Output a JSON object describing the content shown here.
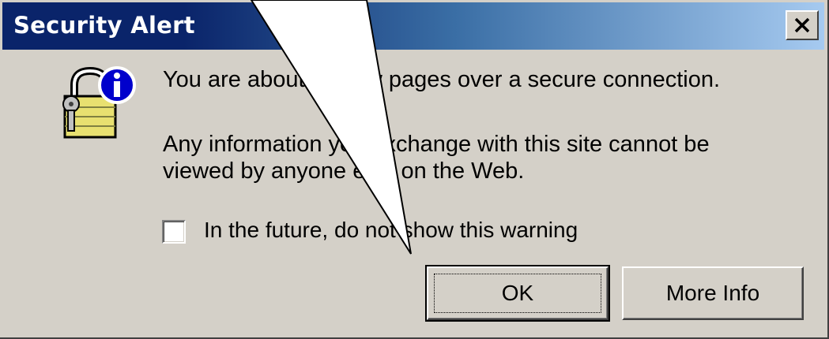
{
  "dialog": {
    "title": "Security Alert",
    "close_label": "✕",
    "message_line1": "You are about to view pages over a secure connection.",
    "message_line2a": "Any information you exchange with this site cannot be",
    "message_line2b": "viewed by anyone else on the Web.",
    "checkbox_label": "In the future, do not show this warning",
    "checkbox_checked": false,
    "ok_label": "OK",
    "more_info_label": "More Info"
  },
  "icons": {
    "lock": "padlock-info-icon",
    "close": "close-icon"
  },
  "colors": {
    "title_start": "#0a246a",
    "title_end": "#a6caf0",
    "face": "#d4d0c8",
    "padlock": "#e8e070"
  }
}
